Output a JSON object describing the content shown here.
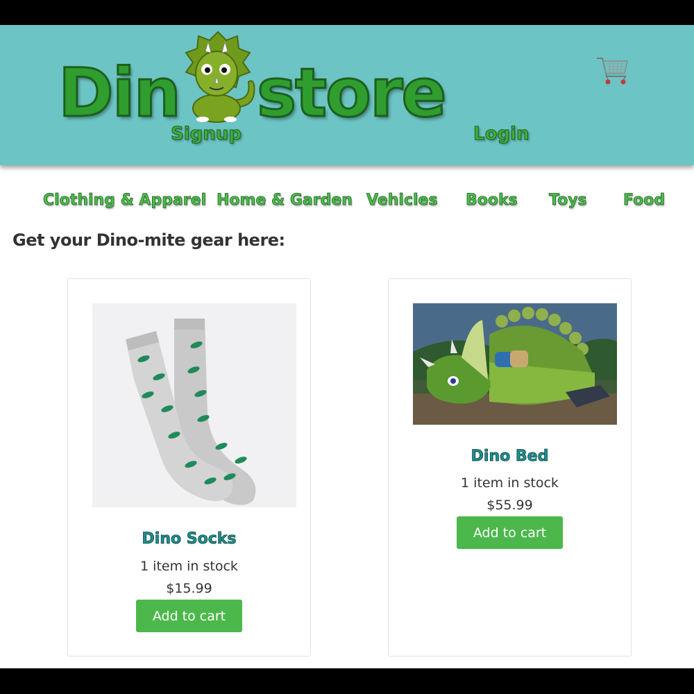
{
  "header": {
    "logo_left": "Din",
    "logo_right": "store",
    "signup_label": "Signup",
    "login_label": "Login",
    "cart_icon": "shopping-cart-icon",
    "background_color": "#6cc4c4"
  },
  "nav": {
    "items": [
      {
        "label": "Clothing & Apparel"
      },
      {
        "label": "Home & Garden"
      },
      {
        "label": "Vehicles"
      },
      {
        "label": "Books"
      },
      {
        "label": "Toys"
      },
      {
        "label": "Food"
      }
    ]
  },
  "main": {
    "tagline": "Get your Dino-mite gear here:",
    "products": [
      {
        "name": "Dino Socks",
        "stock": "1 item in stock",
        "price": "$15.99",
        "button_label": "Add to cart"
      },
      {
        "name": "Dino Bed",
        "stock": "1 item in stock",
        "price": "$55.99",
        "button_label": "Add to cart"
      }
    ]
  },
  "colors": {
    "accent_green": "#4cb84c",
    "product_name_teal": "#1e8f8f"
  }
}
